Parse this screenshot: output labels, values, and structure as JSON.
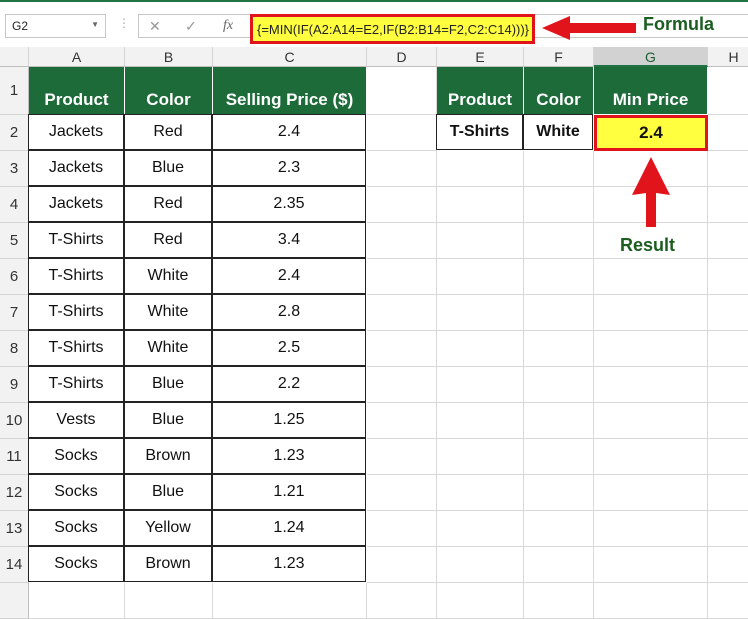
{
  "name_box": "G2",
  "formula_bar": {
    "cancel_icon": "✕",
    "enter_icon": "✓",
    "fx_label": "fx",
    "formula": "{=MIN(IF(A2:A14=E2,IF(B2:B14=F2,C2:C14)))}"
  },
  "annotations": {
    "formula_label": "Formula",
    "result_label": "Result",
    "arrow_color": "#e0141a",
    "label_color": "#1b5e20"
  },
  "columns": [
    "A",
    "B",
    "C",
    "D",
    "E",
    "F",
    "G",
    "H"
  ],
  "rows": [
    "1",
    "2",
    "3",
    "4",
    "5",
    "6",
    "7",
    "8",
    "9",
    "10",
    "11",
    "12",
    "13",
    "14"
  ],
  "table": {
    "headers": [
      "Product",
      "Color",
      "Selling Price ($)"
    ],
    "rows": [
      [
        "Jackets",
        "Red",
        "2.4"
      ],
      [
        "Jackets",
        "Blue",
        "2.3"
      ],
      [
        "Jackets",
        "Red",
        "2.35"
      ],
      [
        "T-Shirts",
        "Red",
        "3.4"
      ],
      [
        "T-Shirts",
        "White",
        "2.4"
      ],
      [
        "T-Shirts",
        "White",
        "2.8"
      ],
      [
        "T-Shirts",
        "White",
        "2.5"
      ],
      [
        "T-Shirts",
        "Blue",
        "2.2"
      ],
      [
        "Vests",
        "Blue",
        "1.25"
      ],
      [
        "Socks",
        "Brown",
        "1.23"
      ],
      [
        "Socks",
        "Blue",
        "1.21"
      ],
      [
        "Socks",
        "Yellow",
        "1.24"
      ],
      [
        "Socks",
        "Brown",
        "1.23"
      ]
    ]
  },
  "lookup": {
    "headers": [
      "Product",
      "Color",
      "Min Price"
    ],
    "values": [
      "T-Shirts",
      "White",
      "2.4"
    ]
  },
  "colors": {
    "header_green": "#1e6b3a",
    "highlight_yellow": "#ffff40"
  }
}
